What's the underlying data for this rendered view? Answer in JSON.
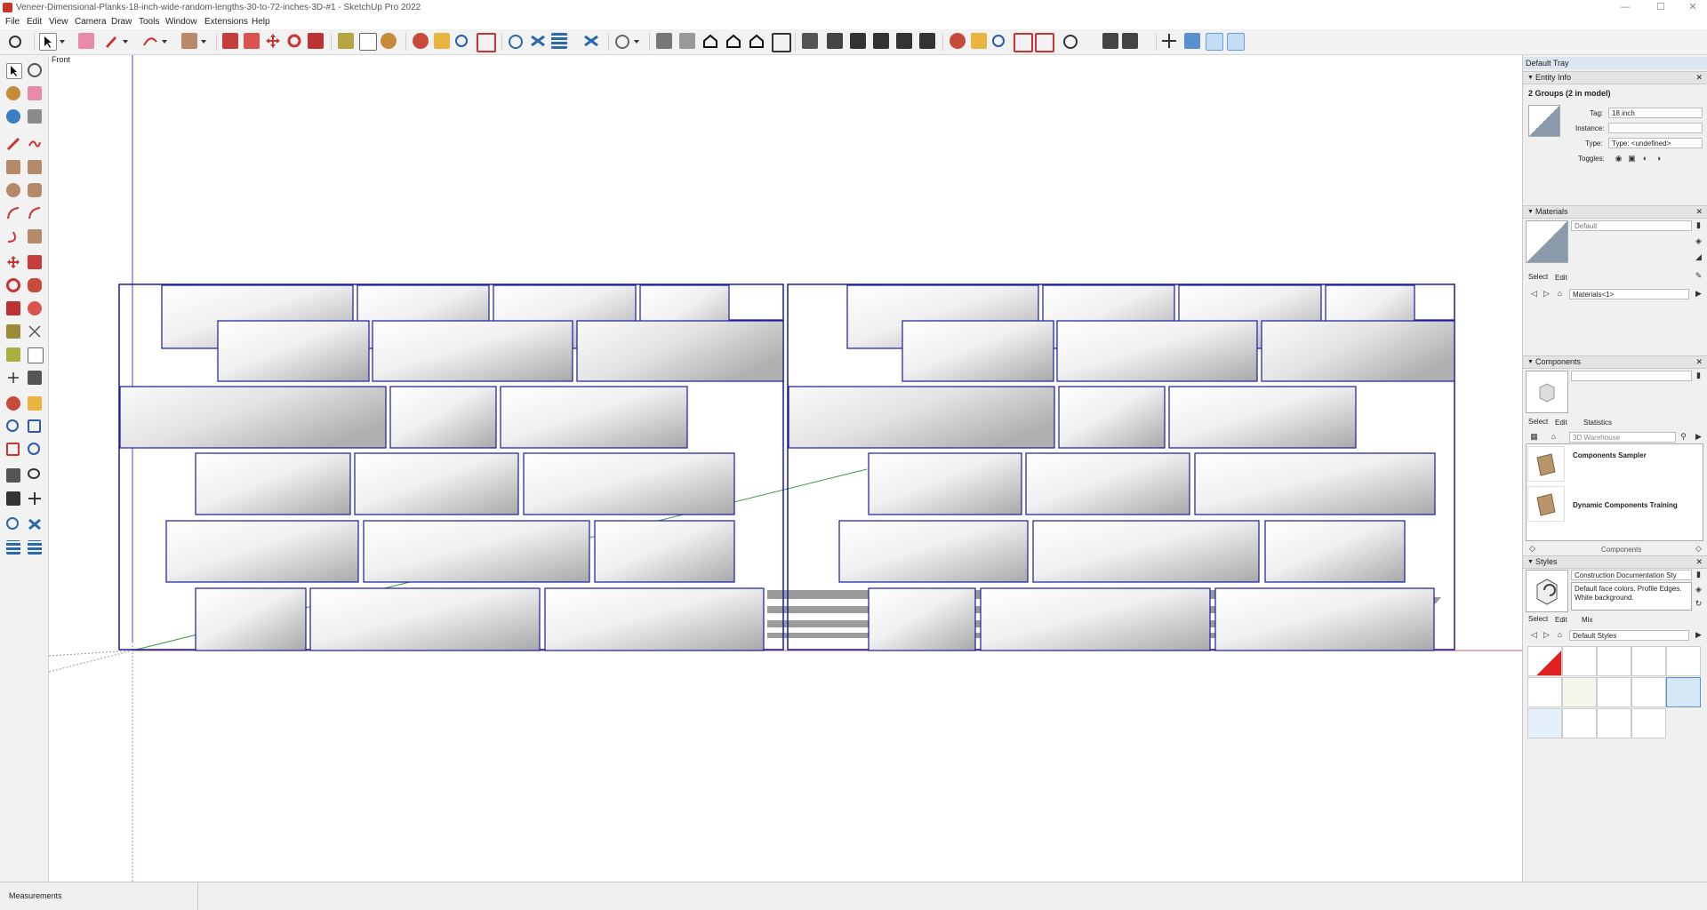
{
  "window": {
    "title": "Veneer-Dimensional-Planks-18-inch-wide-random-lengths-30-to-72-inches-3D-#1 - SketchUp Pro 2022",
    "minimize": "—",
    "maximize": "☐",
    "close": "✕"
  },
  "menu": [
    "File",
    "Edit",
    "View",
    "Camera",
    "Draw",
    "Tools",
    "Window",
    "Extensions",
    "Help"
  ],
  "toolbar_icons": [
    "search-icon",
    "select-icon",
    "dropdown-icon",
    "eraser-icon",
    "pencil-icon",
    "dropdown-icon",
    "shape-icon",
    "dropdown-icon",
    "paint-bucket-icon",
    "dropdown-icon",
    "push-pull-icon",
    "follow-me-icon",
    "move-icon",
    "rotate-icon",
    "scale-icon",
    "tape-measure-icon",
    "text-icon",
    "paint-icon",
    "orbit-icon",
    "pan-icon",
    "zoom-icon",
    "zoom-extents-icon",
    "sandbox-icon",
    "sandbox-icon",
    "sandbox-icon",
    "sandbox-icon",
    "warehouse-icon",
    "dropdown-icon",
    "iso-view-icon",
    "top-view-icon",
    "front-view-icon",
    "right-view-icon",
    "back-view-icon",
    "left-view-icon",
    "xray-icon",
    "back-edges-icon",
    "wireframe-icon",
    "hidden-line-icon",
    "shaded-icon",
    "textured-icon",
    "section-plane-icon",
    "walk-icon",
    "zoom-window-icon",
    "zoom-extents-icon",
    "previous-icon",
    "look-around-icon",
    "position-camera-icon",
    "axes-icon",
    "component-icon",
    "solid-tools-icon",
    "solid-tools-icon"
  ],
  "left_tools": [
    "select-icon",
    "orbit-icon",
    "paint-bucket-icon",
    "eraser-icon",
    "make-component-icon",
    "tape-icon",
    "line-icon",
    "freehand-icon",
    "rectangle-icon",
    "rotated-rectangle-icon",
    "circle-icon",
    "polygon-icon",
    "arc-icon",
    "two-point-arc-icon",
    "three-point-arc-icon",
    "pie-icon",
    "move-icon",
    "push-pull-icon",
    "rotate-icon",
    "follow-me-icon",
    "scale-icon",
    "offset-icon",
    "tape-measure-icon",
    "dimension-icon",
    "protractor-icon",
    "text-icon",
    "axes-icon",
    "3d-text-icon",
    "orbit-icon",
    "pan-icon",
    "zoom-icon",
    "zoom-window-icon",
    "zoom-extents-icon",
    "previous-icon",
    "position-camera-icon",
    "look-around-icon",
    "walk-icon",
    "section-plane-icon",
    "sandbox-from-contours-icon",
    "sandbox-from-scratch-icon",
    "smoove-icon",
    "stamp-icon"
  ],
  "viewport": {
    "view_label": "Front"
  },
  "tray": {
    "title": "Default Tray",
    "entity_info": {
      "header": "Entity Info",
      "selection": "2 Groups (2 in model)",
      "tag_label": "Tag:",
      "tag_value": "18 inch",
      "instance_label": "Instance:",
      "instance_value": "",
      "type_label": "Type:",
      "type_value": "Type: <undefined>",
      "toggles_label": "Toggles:"
    },
    "materials": {
      "header": "Materials",
      "name": "Default",
      "select_tab": "Select",
      "edit_tab": "Edit",
      "library": "Materials<1>"
    },
    "components": {
      "header": "Components",
      "select_tab": "Select",
      "edit_tab": "Edit",
      "statistics_tab": "Statistics",
      "search_placeholder": "3D Warehouse",
      "items": [
        {
          "name": "Components Sampler"
        },
        {
          "name": "Dynamic Components Training"
        }
      ],
      "footer": "Components"
    },
    "styles": {
      "header": "Styles",
      "style_name": "Construction Documentation Sty",
      "description": "Default face colors. Profile Edges. White background.",
      "select_tab": "Select",
      "edit_tab": "Edit",
      "mix_tab": "Mix",
      "collection": "Default Styles"
    }
  },
  "status": {
    "measurements_label": "Measurements"
  }
}
